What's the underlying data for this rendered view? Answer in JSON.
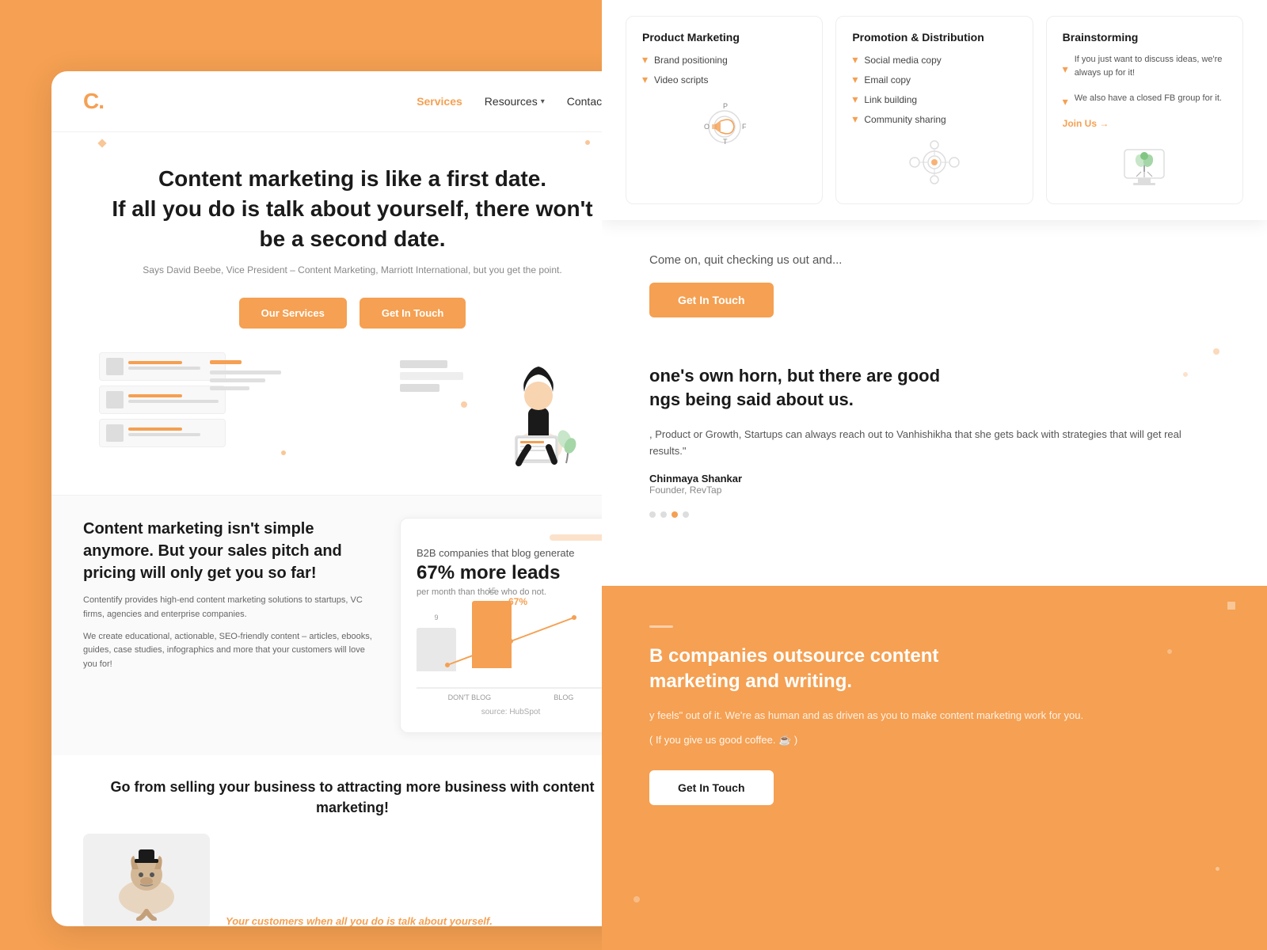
{
  "brand": {
    "logo_letter": "C",
    "logo_dot": "."
  },
  "navbar": {
    "services_label": "Services",
    "resources_label": "Resources",
    "contact_label": "Contact Us"
  },
  "hero": {
    "title_line1": "Content marketing is like a first date.",
    "title_line2": "If all you do is talk about yourself, there won't",
    "title_line3": "be a second date.",
    "subtitle": "Says David Beebe, Vice President – Content Marketing, Marriott International, but you get the point.",
    "btn_services": "Our Services",
    "btn_touch": "Get In Touch"
  },
  "services_dropdown": {
    "product_marketing": {
      "title": "Product Marketing",
      "items": [
        "Brand positioning",
        "Video scripts"
      ]
    },
    "promotion": {
      "title": "Promotion & Distribution",
      "items": [
        "Social media copy",
        "Email copy",
        "Link building",
        "Community sharing"
      ]
    },
    "brainstorming": {
      "title": "Brainstorming",
      "desc1": "If you just want to discuss ideas, we're always up for it!",
      "desc2": "We also have a closed FB group for it.",
      "join_label": "Join Us →"
    }
  },
  "content_section": {
    "title": "Content marketing isn't simple anymore. But your sales pitch and pricing will only get you so far!",
    "desc1": "Contentify provides high-end content marketing solutions to startups, VC firms, agencies and enterprise companies.",
    "desc2": "We create educational, actionable, SEO-friendly content – articles, ebooks, guides, case studies, infographics and more that your customers will love you for!"
  },
  "chart": {
    "intro": "B2B companies that blog generate",
    "highlight": "67% more leads",
    "sub": "per month than those who do not.",
    "bars": [
      {
        "label": "DON'T BLOG",
        "value": 9,
        "highlight": false
      },
      {
        "label": "BLOG",
        "value": 15,
        "highlight": true
      }
    ],
    "percentage_label": "67%",
    "source": "source: HubSpot"
  },
  "bottom_cta": {
    "title": "Go from selling your business to attracting more business with content marketing!",
    "callout": "Your customers when all you do is talk about yourself."
  },
  "right_cta": {
    "text": "Come on, quit checking us out and...",
    "btn_label": "Get In Touch"
  },
  "testimonials": {
    "section_title_part1": "one's own horn, but there are good",
    "section_title_part2": "ngs being said about us.",
    "quote": ", Product or Growth, Startups can always reach out to Vanhishikha that she gets back with strategies that will get real results.\"",
    "author": "Chinmaya Shankar",
    "role": "Founder, RevTap",
    "dots": [
      "inactive",
      "inactive",
      "active",
      "inactive"
    ]
  },
  "orange_bottom": {
    "title_part1": "B companies outsource content",
    "title_part2": "marketing and writing.",
    "subtitle": "y feels\" out of it. We're as human and as driven as you to make content marketing work for you.",
    "coffee_note": "( If you give us good coffee. ☕️ )",
    "btn_label": "Get In Touch"
  }
}
